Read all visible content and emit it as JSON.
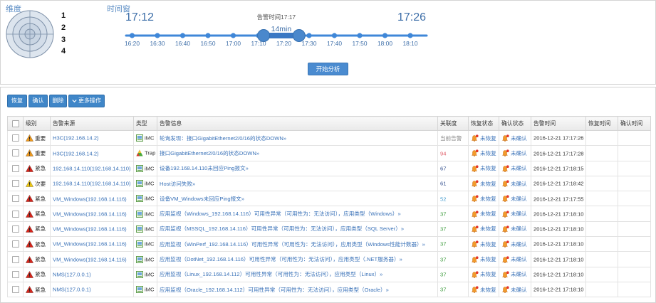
{
  "dimension": {
    "title": "维度",
    "levels": [
      "1",
      "2",
      "3",
      "4"
    ]
  },
  "time_window": {
    "title": "时间窗",
    "start": "17:12",
    "end": "17:26",
    "alarm_time_prefix": "告警时间",
    "alarm_time": "17:17",
    "duration": "14min",
    "ticks": [
      "16:20",
      "16:30",
      "16:40",
      "16:50",
      "17:00",
      "17:10",
      "17:20",
      "17:30",
      "17:40",
      "17:50",
      "18:00",
      "18:10"
    ],
    "analyze_button": "开始分析"
  },
  "toolbar": {
    "recover": "恢复",
    "confirm": "确认",
    "delete": "删除",
    "more": "更多操作",
    "more_icon": "chevron-down-icon"
  },
  "table": {
    "columns": {
      "severity": "级别",
      "source": "告警来源",
      "type": "类型",
      "message": "告警信息",
      "relevance": "关联度",
      "recover_status": "恢复状态",
      "confirm_status": "确认状态",
      "alarm_time": "告警时间",
      "recover_time": "恢复时间",
      "confirm_time": "确认时间"
    },
    "status_icon": "alarm-bell-icon",
    "rows": [
      {
        "severity": "重要",
        "source": "H3C(192.168.14.2)",
        "type": "iMC",
        "type_icon": "imc-icon",
        "message": "轮询发现：接口GigabitEthernet2/0/16的状态DOWN»",
        "relevance": "当前告警",
        "relevance_color": "#8a8a8a",
        "recover_status": "未恢复",
        "confirm_status": "未确认",
        "alarm_time": "2016-12-21 17:17:26"
      },
      {
        "severity": "重要",
        "source": "H3C(192.168.14.2)",
        "type": "Trap",
        "type_icon": "trap-icon",
        "message": "接口GigabitEthernet2/0/16的状态DOWN»",
        "relevance": "94",
        "relevance_color": "#e0606a",
        "recover_status": "未恢复",
        "confirm_status": "未确认",
        "alarm_time": "2016-12-21 17:17:28"
      },
      {
        "severity": "紧急",
        "source": "192.168.14.110(192.168.14.110)",
        "type": "iMC",
        "type_icon": "imc-icon",
        "message": "设备192.168.14.110未回应Ping报文»",
        "relevance": "67",
        "relevance_color": "#34508e",
        "recover_status": "未恢复",
        "confirm_status": "未确认",
        "alarm_time": "2016-12-21 17:18:15"
      },
      {
        "severity": "次要",
        "source": "192.168.14.110(192.168.14.110)",
        "type": "iMC",
        "type_icon": "imc-icon",
        "message": "Host访问失败»",
        "relevance": "61",
        "relevance_color": "#34508e",
        "recover_status": "未恢复",
        "confirm_status": "未确认",
        "alarm_time": "2016-12-21 17:18:42"
      },
      {
        "severity": "紧急",
        "source": "VM_Windows(192.168.14.116)",
        "type": "iMC",
        "type_icon": "imc-icon",
        "message": "设备VM_Windows未回应Ping报文»",
        "relevance": "52",
        "relevance_color": "#4a9fd0",
        "recover_status": "未恢复",
        "confirm_status": "未确认",
        "alarm_time": "2016-12-21 17:17:55"
      },
      {
        "severity": "紧急",
        "source": "VM_Windows(192.168.14.116)",
        "type": "iMC",
        "type_icon": "imc-icon",
        "message": "应用监视（Windows_192.168.14.116）可用性异常（可用性为：无法访问），应用类型（Windows）»",
        "relevance": "37",
        "relevance_color": "#3a9a3a",
        "recover_status": "未恢复",
        "confirm_status": "未确认",
        "alarm_time": "2016-12-21 17:18:10"
      },
      {
        "severity": "紧急",
        "source": "VM_Windows(192.168.14.116)",
        "type": "iMC",
        "type_icon": "imc-icon",
        "message": "应用监视（MSSQL_192.168.14.116）可用性异常（可用性为：无法访问），应用类型（SQL Server）»",
        "relevance": "37",
        "relevance_color": "#3a9a3a",
        "recover_status": "未恢复",
        "confirm_status": "未确认",
        "alarm_time": "2016-12-21 17:18:10"
      },
      {
        "severity": "紧急",
        "source": "VM_Windows(192.168.14.116)",
        "type": "iMC",
        "type_icon": "imc-icon",
        "message": "应用监视（WinPerf_192.168.14.116）可用性异常（可用性为：无法访问），应用类型（Windows性能计数器）»",
        "relevance": "37",
        "relevance_color": "#3a9a3a",
        "recover_status": "未恢复",
        "confirm_status": "未确认",
        "alarm_time": "2016-12-21 17:18:10"
      },
      {
        "severity": "紧急",
        "source": "VM_Windows(192.168.14.116)",
        "type": "iMC",
        "type_icon": "imc-icon",
        "message": "应用监视（DotNet_192.168.14.116）可用性异常（可用性为：无法访问），应用类型（.NET服务器）»",
        "relevance": "37",
        "relevance_color": "#3a9a3a",
        "recover_status": "未恢复",
        "confirm_status": "未确认",
        "alarm_time": "2016-12-21 17:18:10"
      },
      {
        "severity": "紧急",
        "source": "NMS(127.0.0.1)",
        "type": "iMC",
        "type_icon": "imc-icon",
        "message": "应用监视（Linux_192.168.14.112）可用性异常（可用性为：无法访问），应用类型（Linux）»",
        "relevance": "37",
        "relevance_color": "#3a9a3a",
        "recover_status": "未恢复",
        "confirm_status": "未确认",
        "alarm_time": "2016-12-21 17:18:10"
      },
      {
        "severity": "紧急",
        "source": "NMS(127.0.0.1)",
        "type": "iMC",
        "type_icon": "imc-icon",
        "message": "应用监视（Oracle_192.168.14.112）可用性异常（可用性为：无法访问），应用类型（Oracle）»",
        "relevance": "37",
        "relevance_color": "#3a9a3a",
        "recover_status": "未恢复",
        "confirm_status": "未确认",
        "alarm_time": "2016-12-21 17:18:10"
      }
    ]
  },
  "colors": {
    "accent": "#3f86c8",
    "link": "#3a72b8",
    "severity": {
      "重要": "#f29b1d",
      "紧急": "#d9261c",
      "次要": "#f3cb14"
    }
  }
}
